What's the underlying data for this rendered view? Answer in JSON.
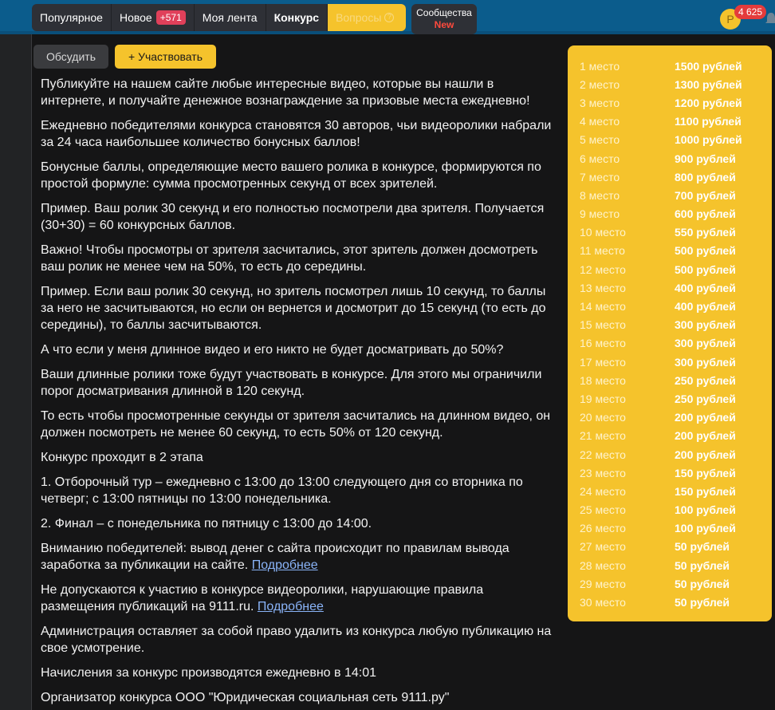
{
  "nav": {
    "items": [
      {
        "label": "Популярное"
      },
      {
        "label": "Новое",
        "badge": "+571"
      },
      {
        "label": "Моя лента"
      },
      {
        "label": "Конкурс"
      },
      {
        "label": "Вопросы"
      }
    ],
    "communities_label": "Сообщества",
    "communities_badge": "New"
  },
  "user": {
    "avatar_letter": "P",
    "notifications": "4 625"
  },
  "actions": {
    "discuss_label": "Обсудить",
    "join_label": "+ Участвовать"
  },
  "content": {
    "p1": "Публикуйте на нашем сайте любые интересные видео, которые вы нашли в интернете, и получайте денежное вознаграждение за призовые места ежедневно!",
    "p2": "Ежедневно победителями конкурса становятся 30 авторов, чьи видеоролики набрали за 24 часа наибольшее количество бонусных баллов!",
    "p3": "Бонусные баллы, определяющие место вашего ролика в конкурсе, формируются по простой формуле: сумма просмотренных секунд от всех зрителей.",
    "p4": "Пример. Ваш ролик 30 секунд и его полностью посмотрели два зрителя. Получается (30+30) = 60 конкурсных баллов.",
    "p5": "Важно! Чтобы просмотры от зрителя засчитались, этот зритель должен досмотреть ваш ролик не менее чем на 50%, то есть до середины.",
    "p6": "Пример. Если ваш ролик 30 секунд, но зритель посмотрел лишь 10 секунд, то баллы за него не засчитываются, но если он вернется и досмотрит до 15 секунд (то есть до середины), то баллы засчитываются.",
    "p7": "А что если у меня длинное видео и его никто не будет досматривать до 50%?",
    "p8": "Ваши длинные ролики тоже будут участвовать в конкурсе. Для этого мы ограничили порог досматривания длинной в 120 секунд.",
    "p9": "То есть чтобы просмотренные секунды от зрителя засчитались на длинном видео, он должен посмотреть не менее 60 секунд, то есть 50% от 120 секунд.",
    "p10": "Конкурс проходит в 2 этапа",
    "p11": "1. Отборочный тур – ежедневно с 13:00 до 13:00 следующего дня со вторника по четверг; с 13:00 пятницы по 13:00 понедельника.",
    "p12": "2. Финал – с понедельника по пятницу с 13:00 до 14:00.",
    "p13": "Вниманию победителей: вывод денег с сайта происходит по правилам вывода заработка за публикации на сайте.",
    "p14": "Не допускаются к участию в конкурсе видеоролики, нарушающие правила размещения публикаций на 9111.ru.",
    "p15": "Администрация оставляет за собой право удалить из конкурса любую публикацию на свое усмотрение.",
    "p16": "Начисления за конкурс производятся ежедневно в 14:01",
    "p17": "Организатор конкурса ООО \"Юридическая социальная сеть 9111.ру\"",
    "more_link": "Подробнее"
  },
  "prizes": [
    {
      "place": "1 место",
      "amount": "1500 рублей"
    },
    {
      "place": "2 место",
      "amount": "1300 рублей"
    },
    {
      "place": "3 место",
      "amount": "1200 рублей"
    },
    {
      "place": "4 место",
      "amount": "1100 рублей"
    },
    {
      "place": "5 место",
      "amount": "1000 рублей"
    },
    {
      "place": "6 место",
      "amount": "900 рублей"
    },
    {
      "place": "7 место",
      "amount": "800 рублей"
    },
    {
      "place": "8 место",
      "amount": "700 рублей"
    },
    {
      "place": "9 место",
      "amount": "600 рублей"
    },
    {
      "place": "10 место",
      "amount": "550 рублей"
    },
    {
      "place": "11 место",
      "amount": "500 рублей"
    },
    {
      "place": "12 место",
      "amount": "500 рублей"
    },
    {
      "place": "13 место",
      "amount": "400 рублей"
    },
    {
      "place": "14 место",
      "amount": "400 рублей"
    },
    {
      "place": "15 место",
      "amount": "300 рублей"
    },
    {
      "place": "16 место",
      "amount": "300 рублей"
    },
    {
      "place": "17 место",
      "amount": "300 рублей"
    },
    {
      "place": "18 место",
      "amount": "250 рублей"
    },
    {
      "place": "19 место",
      "amount": "250 рублей"
    },
    {
      "place": "20 место",
      "amount": "200 рублей"
    },
    {
      "place": "21 место",
      "amount": "200 рублей"
    },
    {
      "place": "22 место",
      "amount": "200 рублей"
    },
    {
      "place": "23 место",
      "amount": "150 рублей"
    },
    {
      "place": "24 место",
      "amount": "150 рублей"
    },
    {
      "place": "25 место",
      "amount": "100 рублей"
    },
    {
      "place": "26 место",
      "amount": "100 рублей"
    },
    {
      "place": "27 место",
      "amount": "50 рублей"
    },
    {
      "place": "28 место",
      "amount": "50 рублей"
    },
    {
      "place": "29 место",
      "amount": "50 рублей"
    },
    {
      "place": "30 место",
      "amount": "50 рублей"
    }
  ]
}
